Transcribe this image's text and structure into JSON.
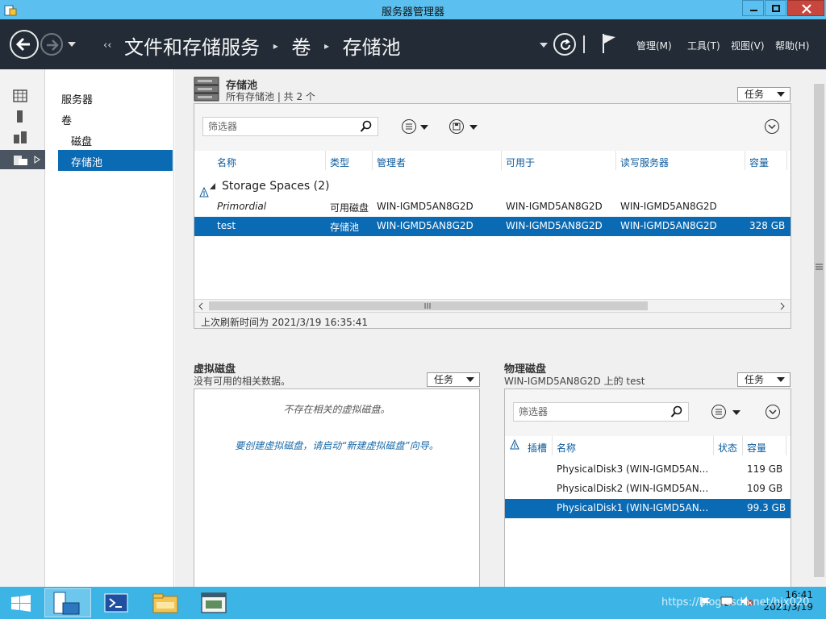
{
  "window": {
    "title": "服务器管理器"
  },
  "nav": {
    "breadcrumb": [
      "文件和存储服务",
      "卷",
      "存储池"
    ],
    "menus": [
      "管理(M)",
      "工具(T)",
      "视图(V)",
      "帮助(H)"
    ]
  },
  "tree": {
    "items": [
      "服务器",
      "卷",
      "磁盘",
      "存储池"
    ],
    "selected": "存储池"
  },
  "pools": {
    "title": "存储池",
    "subtitle": "所有存储池 | 共 2 个",
    "task_label": "任务",
    "filter_placeholder": "筛选器",
    "columns": [
      "名称",
      "类型",
      "管理者",
      "可用于",
      "读写服务器",
      "容量"
    ],
    "group_label": "Storage Spaces (2)",
    "rows": [
      {
        "name": "Primordial",
        "type": "可用磁盘",
        "managed_by": "WIN-IGMD5AN8G2D",
        "available_to": "WIN-IGMD5AN8G2D",
        "rw_server": "WIN-IGMD5AN8G2D",
        "capacity": ""
      },
      {
        "name": "test",
        "type": "存储池",
        "managed_by": "WIN-IGMD5AN8G2D",
        "available_to": "WIN-IGMD5AN8G2D",
        "rw_server": "WIN-IGMD5AN8G2D",
        "capacity": "328 GB"
      }
    ],
    "last_refresh": "上次刷新时间为 2021/3/19 16:35:41"
  },
  "virtual_disks": {
    "title": "虚拟磁盘",
    "subtitle": "没有可用的相关数据。",
    "task_label": "任务",
    "empty_msg": "不存在相关的虚拟磁盘。",
    "hint_msg": "要创建虚拟磁盘，请启动“新建虚拟磁盘”向导。"
  },
  "physical_disks": {
    "title": "物理磁盘",
    "subtitle": "WIN-IGMD5AN8G2D 上的 test",
    "task_label": "任务",
    "filter_placeholder": "筛选器",
    "columns": [
      "插槽",
      "名称",
      "状态",
      "容量"
    ],
    "rows": [
      {
        "name": "PhysicalDisk3 (WIN-IGMD5AN...",
        "capacity": "119 GB"
      },
      {
        "name": "PhysicalDisk2 (WIN-IGMD5AN...",
        "capacity": "109 GB"
      },
      {
        "name": "PhysicalDisk1 (WIN-IGMD5AN...",
        "capacity": "99.3 GB"
      }
    ]
  },
  "taskbar": {
    "time": "16:41",
    "date": "2021/3/19",
    "watermark": "https://blog.csdn.net/hjx020"
  },
  "colors": {
    "titlebar": "#5bc0f0",
    "navbar": "#222b36",
    "selection": "#0a6ab3",
    "taskbar": "#3cb4e6"
  }
}
